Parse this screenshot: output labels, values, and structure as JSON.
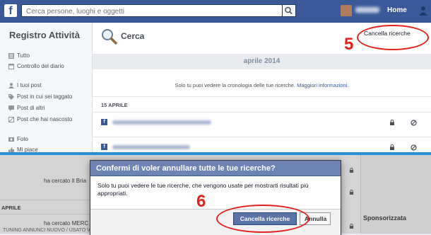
{
  "topbar": {
    "logo": "f",
    "search_placeholder": "Cerca persone, luoghi e oggetti",
    "home_label": "Home"
  },
  "sidebar": {
    "title": "Registro Attività",
    "items": [
      {
        "label": "Tutto",
        "icon": "list-icon"
      },
      {
        "label": "Controllo del diario",
        "icon": "calendar-icon"
      },
      {
        "label": "I tuoi post",
        "icon": "person-icon"
      },
      {
        "label": "Post in cui sei taggato",
        "icon": "tag-icon"
      },
      {
        "label": "Post di altri",
        "icon": "comment-icon"
      },
      {
        "label": "Post che hai nascosto",
        "icon": "hidden-icon"
      },
      {
        "label": "Foto",
        "icon": "photo-icon"
      },
      {
        "label": "Mi piace",
        "icon": "like-icon"
      }
    ]
  },
  "main": {
    "title": "Cerca",
    "cancel_label": "Cancella ricerche",
    "annotation_step5": "5",
    "month": "aprile 2014",
    "privacy_text": "Solo tu puoi vedere la cronologia delle tue ricerche. ",
    "privacy_link": "Maggiori informazioni.",
    "day": "15 APRILE"
  },
  "background": {
    "search_1": "ha cercato Il Bria",
    "month_label": "APRILE",
    "search_2": "ha cercato MERC",
    "search_3": "TUNING ANNUNCI NUOVO / USATO VENDO C",
    "sponsored": "Sponsorizzata"
  },
  "dialog": {
    "title": "Confermi di voler annullare tutte le tue ricerche?",
    "body": "Solo tu puoi vedere le tue ricerche, che vengono usate per mostrarti risultati più appropriati.",
    "confirm_label": "Cancella ricerche",
    "cancel_label": "Annulla",
    "annotation_step6": "6"
  },
  "colors": {
    "facebook_blue": "#3b5998",
    "annotation_red": "#e3201b",
    "separator_blue": "#2c8fd4"
  }
}
